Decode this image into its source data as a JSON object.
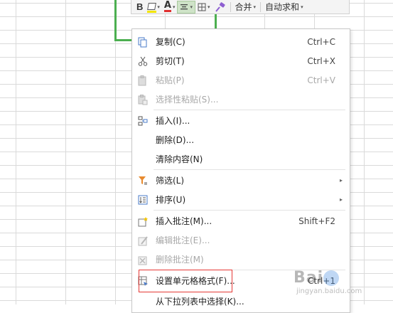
{
  "toolbar": {
    "bold_label": "B",
    "font_color_label": "A",
    "merge_label": "合并",
    "autosum_label": "自动求和",
    "dropdown_glyph": "▾"
  },
  "menu": {
    "copy": {
      "label": "复制(C)",
      "shortcut": "Ctrl+C"
    },
    "cut": {
      "label": "剪切(T)",
      "shortcut": "Ctrl+X"
    },
    "paste": {
      "label": "粘贴(P)",
      "shortcut": "Ctrl+V"
    },
    "paste_special": {
      "label": "选择性粘贴(S)..."
    },
    "insert": {
      "label": "插入(I)..."
    },
    "delete": {
      "label": "删除(D)..."
    },
    "clear": {
      "label": "清除内容(N)"
    },
    "filter": {
      "label": "筛选(L)"
    },
    "sort": {
      "label": "排序(U)"
    },
    "insert_comment": {
      "label": "插入批注(M)...",
      "shortcut": "Shift+F2"
    },
    "edit_comment": {
      "label": "编辑批注(E)..."
    },
    "delete_comment": {
      "label": "删除批注(M)"
    },
    "format_cells": {
      "label": "设置单元格格式(F)...",
      "shortcut": "Ctrl+1"
    },
    "pick_from_list": {
      "label": "从下拉列表中选择(K)..."
    },
    "submenu_arrow": "▸"
  },
  "watermark": {
    "text": "Bai",
    "sub": "jingyan.baidu.com"
  },
  "colors": {
    "selection_border": "#4caf50",
    "highlight_box": "#e53935",
    "disabled_text": "#a8a8a8",
    "font_color_bar": "#e03030",
    "fill_color_bar": "#f3e500"
  }
}
